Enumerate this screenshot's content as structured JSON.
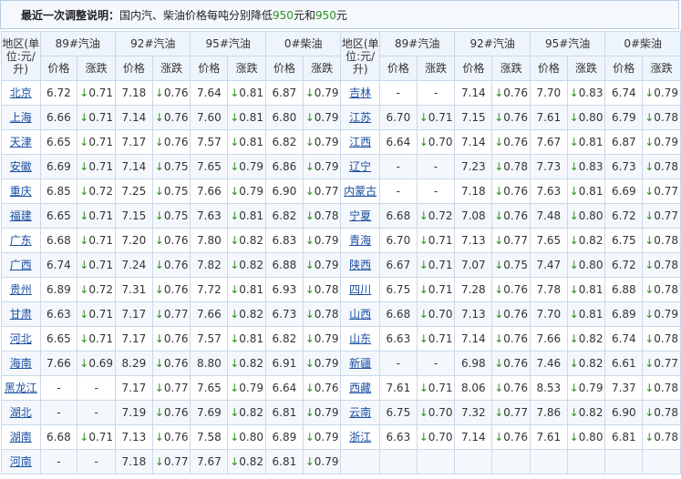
{
  "notice": {
    "prefix": "最近一次调整说明：",
    "text_a": "国内汽、柴油价格每吨分别降低",
    "val_gas": "950",
    "text_b": "元和",
    "val_diesel": "950",
    "text_c": "元"
  },
  "header": {
    "area": "地区(单位:元/升)",
    "fuels": [
      "89#汽油",
      "92#汽油",
      "95#汽油",
      "0#柴油"
    ],
    "price": "价格",
    "change": "涨跌"
  },
  "arrow": "↓",
  "left_rows": [
    {
      "city": "北京",
      "p89": "6.72",
      "c89": "0.71",
      "p92": "7.18",
      "c92": "0.76",
      "p95": "7.64",
      "c95": "0.81",
      "p0": "6.87",
      "c0": "0.79"
    },
    {
      "city": "上海",
      "p89": "6.66",
      "c89": "0.71",
      "p92": "7.14",
      "c92": "0.76",
      "p95": "7.60",
      "c95": "0.81",
      "p0": "6.80",
      "c0": "0.79"
    },
    {
      "city": "天津",
      "p89": "6.65",
      "c89": "0.71",
      "p92": "7.17",
      "c92": "0.76",
      "p95": "7.57",
      "c95": "0.81",
      "p0": "6.82",
      "c0": "0.79"
    },
    {
      "city": "安徽",
      "p89": "6.69",
      "c89": "0.71",
      "p92": "7.14",
      "c92": "0.75",
      "p95": "7.65",
      "c95": "0.79",
      "p0": "6.86",
      "c0": "0.79"
    },
    {
      "city": "重庆",
      "p89": "6.85",
      "c89": "0.72",
      "p92": "7.25",
      "c92": "0.75",
      "p95": "7.66",
      "c95": "0.79",
      "p0": "6.90",
      "c0": "0.77"
    },
    {
      "city": "福建",
      "p89": "6.65",
      "c89": "0.71",
      "p92": "7.15",
      "c92": "0.75",
      "p95": "7.63",
      "c95": "0.81",
      "p0": "6.82",
      "c0": "0.78"
    },
    {
      "city": "广东",
      "p89": "6.68",
      "c89": "0.71",
      "p92": "7.20",
      "c92": "0.76",
      "p95": "7.80",
      "c95": "0.82",
      "p0": "6.83",
      "c0": "0.79"
    },
    {
      "city": "广西",
      "p89": "6.74",
      "c89": "0.71",
      "p92": "7.24",
      "c92": "0.76",
      "p95": "7.82",
      "c95": "0.82",
      "p0": "6.88",
      "c0": "0.79"
    },
    {
      "city": "贵州",
      "p89": "6.89",
      "c89": "0.72",
      "p92": "7.31",
      "c92": "0.76",
      "p95": "7.72",
      "c95": "0.81",
      "p0": "6.93",
      "c0": "0.78"
    },
    {
      "city": "甘肃",
      "p89": "6.63",
      "c89": "0.71",
      "p92": "7.17",
      "c92": "0.77",
      "p95": "7.66",
      "c95": "0.82",
      "p0": "6.73",
      "c0": "0.78"
    },
    {
      "city": "河北",
      "p89": "6.65",
      "c89": "0.71",
      "p92": "7.17",
      "c92": "0.76",
      "p95": "7.57",
      "c95": "0.81",
      "p0": "6.82",
      "c0": "0.79"
    },
    {
      "city": "海南",
      "p89": "7.66",
      "c89": "0.69",
      "p92": "8.29",
      "c92": "0.76",
      "p95": "8.80",
      "c95": "0.82",
      "p0": "6.91",
      "c0": "0.79"
    },
    {
      "city": "黑龙江",
      "p89": "-",
      "c89": "-",
      "p92": "7.17",
      "c92": "0.77",
      "p95": "7.65",
      "c95": "0.79",
      "p0": "6.64",
      "c0": "0.76"
    },
    {
      "city": "湖北",
      "p89": "-",
      "c89": "-",
      "p92": "7.19",
      "c92": "0.76",
      "p95": "7.69",
      "c95": "0.82",
      "p0": "6.81",
      "c0": "0.79"
    },
    {
      "city": "湖南",
      "p89": "6.68",
      "c89": "0.71",
      "p92": "7.13",
      "c92": "0.76",
      "p95": "7.58",
      "c95": "0.80",
      "p0": "6.89",
      "c0": "0.79"
    },
    {
      "city": "河南",
      "p89": "-",
      "c89": "-",
      "p92": "7.18",
      "c92": "0.77",
      "p95": "7.67",
      "c95": "0.82",
      "p0": "6.81",
      "c0": "0.79"
    }
  ],
  "right_rows": [
    {
      "city": "吉林",
      "p89": "-",
      "c89": "-",
      "p92": "7.14",
      "c92": "0.76",
      "p95": "7.70",
      "c95": "0.83",
      "p0": "6.74",
      "c0": "0.79"
    },
    {
      "city": "江苏",
      "p89": "6.70",
      "c89": "0.71",
      "p92": "7.15",
      "c92": "0.76",
      "p95": "7.61",
      "c95": "0.80",
      "p0": "6.79",
      "c0": "0.78"
    },
    {
      "city": "江西",
      "p89": "6.64",
      "c89": "0.70",
      "p92": "7.14",
      "c92": "0.76",
      "p95": "7.67",
      "c95": "0.81",
      "p0": "6.87",
      "c0": "0.79"
    },
    {
      "city": "辽宁",
      "p89": "-",
      "c89": "-",
      "p92": "7.23",
      "c92": "0.78",
      "p95": "7.73",
      "c95": "0.83",
      "p0": "6.73",
      "c0": "0.78"
    },
    {
      "city": "内蒙古",
      "p89": "-",
      "c89": "-",
      "p92": "7.18",
      "c92": "0.76",
      "p95": "7.63",
      "c95": "0.81",
      "p0": "6.69",
      "c0": "0.77"
    },
    {
      "city": "宁夏",
      "p89": "6.68",
      "c89": "0.72",
      "p92": "7.08",
      "c92": "0.76",
      "p95": "7.48",
      "c95": "0.80",
      "p0": "6.72",
      "c0": "0.77"
    },
    {
      "city": "青海",
      "p89": "6.70",
      "c89": "0.71",
      "p92": "7.13",
      "c92": "0.77",
      "p95": "7.65",
      "c95": "0.82",
      "p0": "6.75",
      "c0": "0.78"
    },
    {
      "city": "陕西",
      "p89": "6.67",
      "c89": "0.71",
      "p92": "7.07",
      "c92": "0.75",
      "p95": "7.47",
      "c95": "0.80",
      "p0": "6.72",
      "c0": "0.78"
    },
    {
      "city": "四川",
      "p89": "6.75",
      "c89": "0.71",
      "p92": "7.28",
      "c92": "0.76",
      "p95": "7.78",
      "c95": "0.81",
      "p0": "6.88",
      "c0": "0.78"
    },
    {
      "city": "山西",
      "p89": "6.68",
      "c89": "0.70",
      "p92": "7.13",
      "c92": "0.76",
      "p95": "7.70",
      "c95": "0.81",
      "p0": "6.89",
      "c0": "0.79"
    },
    {
      "city": "山东",
      "p89": "6.63",
      "c89": "0.71",
      "p92": "7.14",
      "c92": "0.76",
      "p95": "7.66",
      "c95": "0.82",
      "p0": "6.74",
      "c0": "0.78"
    },
    {
      "city": "新疆",
      "p89": "-",
      "c89": "-",
      "p92": "6.98",
      "c92": "0.76",
      "p95": "7.46",
      "c95": "0.82",
      "p0": "6.61",
      "c0": "0.77"
    },
    {
      "city": "西藏",
      "p89": "7.61",
      "c89": "0.71",
      "p92": "8.06",
      "c92": "0.76",
      "p95": "8.53",
      "c95": "0.79",
      "p0": "7.37",
      "c0": "0.78"
    },
    {
      "city": "云南",
      "p89": "6.75",
      "c89": "0.70",
      "p92": "7.32",
      "c92": "0.77",
      "p95": "7.86",
      "c95": "0.82",
      "p0": "6.90",
      "c0": "0.78"
    },
    {
      "city": "浙江",
      "p89": "6.63",
      "c89": "0.70",
      "p92": "7.14",
      "c92": "0.76",
      "p95": "7.61",
      "c95": "0.80",
      "p0": "6.81",
      "c0": "0.78"
    },
    {
      "city": "",
      "p89": "",
      "c89": "",
      "p92": "",
      "c92": "",
      "p95": "",
      "c95": "",
      "p0": "",
      "c0": ""
    }
  ]
}
